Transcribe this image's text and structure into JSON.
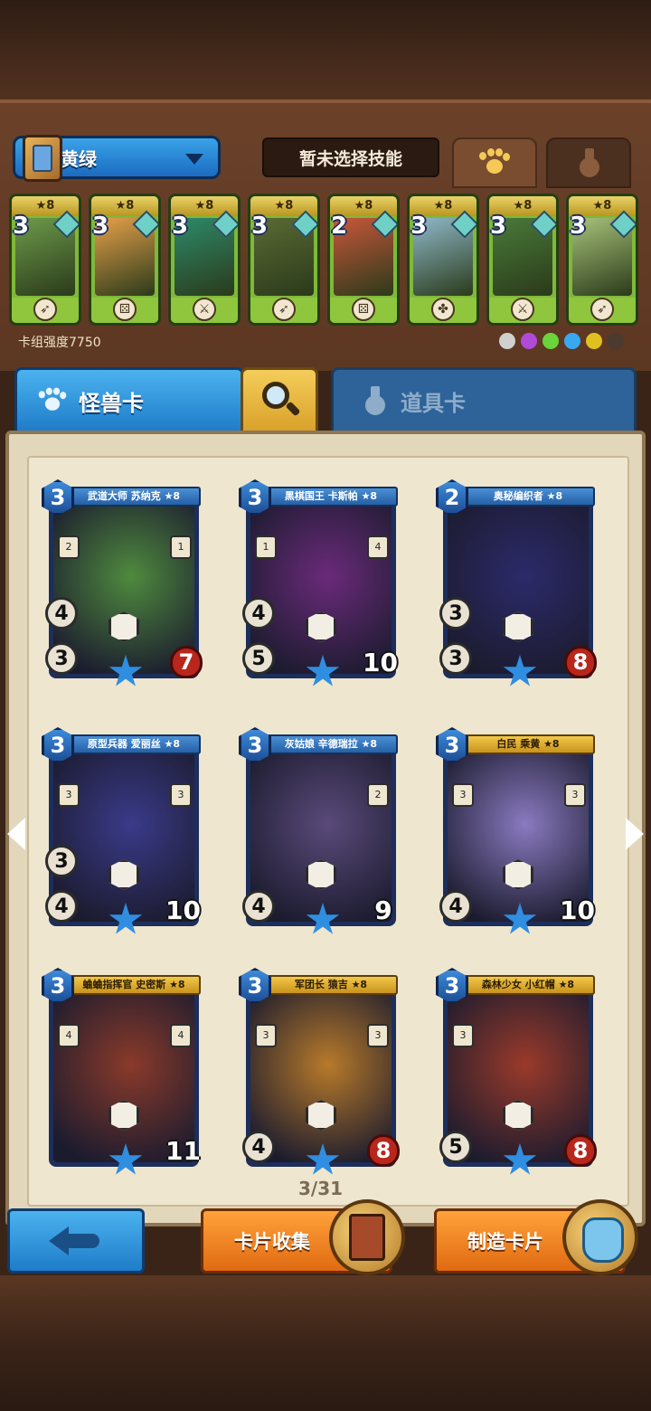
{
  "header": {
    "deck_name": "黄绿",
    "skill_label": "暂未选择技能",
    "deck_strength": "卡组强度7750"
  },
  "deck_cards": [
    {
      "stars": "★8",
      "cost": "3",
      "art": "#6e9a4a",
      "icon": "bow"
    },
    {
      "stars": "★8",
      "cost": "3",
      "art": "#e6a04a",
      "icon": "dice"
    },
    {
      "stars": "★8",
      "cost": "3",
      "art": "#2d8a6a",
      "icon": "sword"
    },
    {
      "stars": "★8",
      "cost": "3",
      "art": "#5b6a34",
      "icon": "bow"
    },
    {
      "stars": "★8",
      "cost": "2",
      "art": "#c8563a",
      "icon": "dice"
    },
    {
      "stars": "★8",
      "cost": "3",
      "art": "#8fb9c9",
      "icon": "clover"
    },
    {
      "stars": "★8",
      "cost": "3",
      "art": "#4a7a3a",
      "icon": "sword"
    },
    {
      "stars": "★8",
      "cost": "3",
      "art": "#a8c27a",
      "icon": "bow"
    }
  ],
  "faction_colors": [
    "#d0d0d0",
    "#b04ad8",
    "#6ad43a",
    "#3aa8f0",
    "#e0c020",
    "#4a3a30"
  ],
  "tabs": {
    "monster": "怪兽卡",
    "item": "道具卡"
  },
  "cards": [
    {
      "name": "武道大师 苏纳克 ★8",
      "cost": "3",
      "left_top": "4",
      "left_bottom": "3",
      "hp": "7",
      "side_l": "2",
      "side_r": "1",
      "art": "#4f8a3e",
      "banner": "blue"
    },
    {
      "name": "黑棋国王 卡斯帕 ★8",
      "cost": "3",
      "left_top": "4",
      "left_bottom": "5",
      "hp": "10",
      "side_l": "1",
      "side_r": "4",
      "art": "#6a2a7a",
      "banner": "blue"
    },
    {
      "name": "奥秘编织者 ★8",
      "cost": "2",
      "left_top": "3",
      "left_bottom": "3",
      "hp": "8",
      "side_l": "",
      "side_r": "",
      "art": "#2c2a6a",
      "banner": "blue"
    },
    {
      "name": "原型兵器 爱丽丝 ★8",
      "cost": "3",
      "left_top": "3",
      "left_bottom": "4",
      "hp": "10",
      "side_l": "3",
      "side_r": "3",
      "art": "#3a3a8a",
      "banner": "blue"
    },
    {
      "name": "灰姑娘 辛德瑞拉 ★8",
      "cost": "3",
      "left_top": "",
      "left_bottom": "4",
      "hp": "9",
      "side_l": "",
      "side_r": "2",
      "art": "#5a4a7a",
      "banner": "blue"
    },
    {
      "name": "白民 乘黄 ★8",
      "cost": "3",
      "left_top": "",
      "left_bottom": "4",
      "hp": "10",
      "side_l": "3",
      "side_r": "3",
      "art": "#8a7ac0",
      "banner": "gold"
    },
    {
      "name": "蛐蛐指挥官 史密斯 ★8",
      "cost": "3",
      "left_top": "",
      "left_bottom": "",
      "hp": "11",
      "side_l": "4",
      "side_r": "4",
      "art": "#8a3a2a",
      "banner": "gold"
    },
    {
      "name": "军团长 猿吉 ★8",
      "cost": "3",
      "left_top": "",
      "left_bottom": "4",
      "hp": "8",
      "side_l": "3",
      "side_r": "3",
      "art": "#b87a2a",
      "banner": "gold"
    },
    {
      "name": "森林少女 小红帽 ★8",
      "cost": "3",
      "left_top": "",
      "left_bottom": "5",
      "hp": "8",
      "side_l": "3",
      "side_r": "",
      "art": "#9a3a2a",
      "banner": "gold"
    }
  ],
  "pagination": "3/31",
  "buttons": {
    "collect": "卡片收集",
    "craft": "制造卡片"
  }
}
